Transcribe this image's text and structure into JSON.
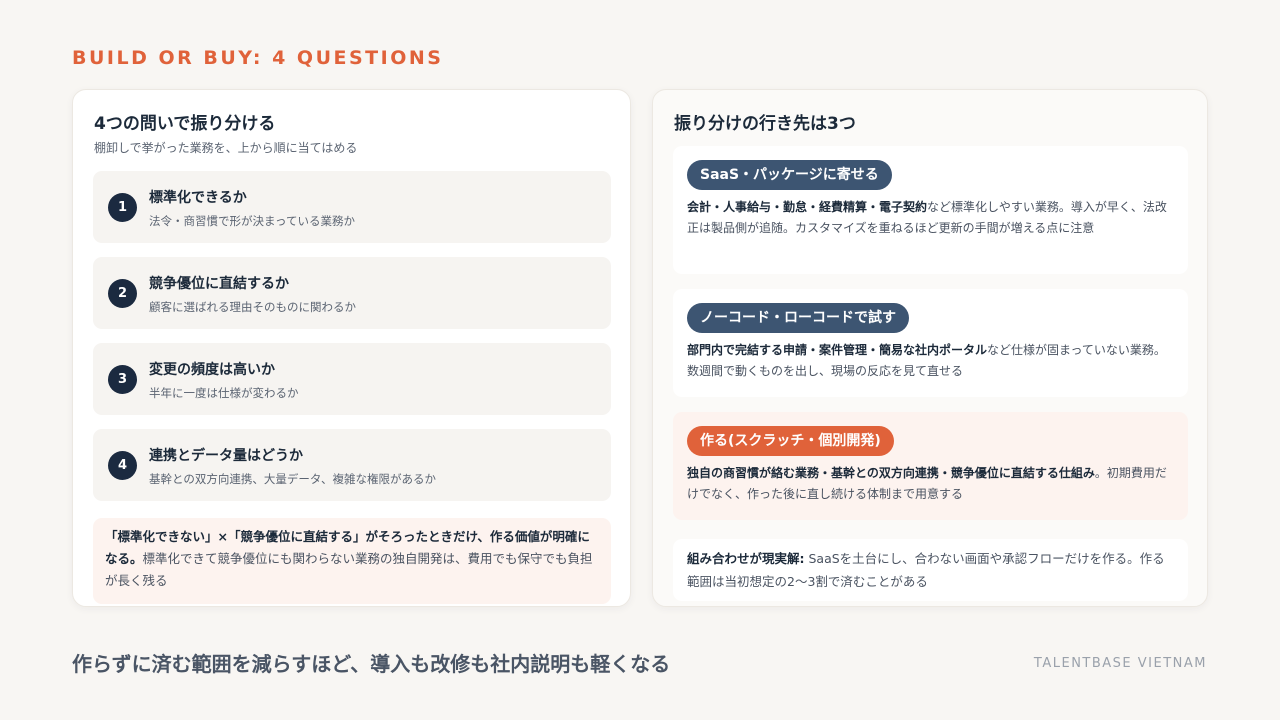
{
  "eyebrow": "BUILD OR BUY: 4 QUESTIONS",
  "left": {
    "title": "4つの問いで振り分ける",
    "subtitle": "棚卸しで挙がった業務を、上から順に当てはめる",
    "questions": [
      {
        "num": "1",
        "title": "標準化できるか",
        "desc": "法令・商習慣で形が決まっている業務か"
      },
      {
        "num": "2",
        "title": "競争優位に直結するか",
        "desc": "顧客に選ばれる理由そのものに関わるか"
      },
      {
        "num": "3",
        "title": "変更の頻度は高いか",
        "desc": "半年に一度は仕様が変わるか"
      },
      {
        "num": "4",
        "title": "連携とデータ量はどうか",
        "desc": "基幹との双方向連携、大量データ、複雑な権限があるか"
      }
    ],
    "note_bold": "「標準化できない」×「競争優位に直結する」がそろったときだけ、作る価値が明確になる。",
    "note_rest": "標準化できて競争優位にも関わらない業務の独自開発は、費用でも保守でも負担が長く残る"
  },
  "right": {
    "title": "振り分けの行き先は3つ",
    "destinations": [
      {
        "label": "SaaS・パッケージに寄せる",
        "bold": "会計・人事給与・勤怠・経費精算・電子契約",
        "rest": "など標準化しやすい業務。導入が早く、法改正は製品側が追随。カスタマイズを重ねるほど更新の手間が増える点に注意"
      },
      {
        "label": "ノーコード・ローコードで試す",
        "bold": "部門内で完結する申請・案件管理・簡易な社内ポータル",
        "rest": "など仕様が固まっていない業務。数週間で動くものを出し、現場の反応を見て直せる"
      },
      {
        "label": "作る(スクラッチ・個別開発)",
        "bold": "独自の商習慣が絡む業務・基幹との双方向連携・競争優位に直結する仕組み",
        "rest": "。初期費用だけでなく、作った後に直し続ける体制まで用意する"
      }
    ],
    "combo_bold": "組み合わせが現実解:",
    "combo_rest": " SaaSを土台にし、合わない画面や承認フローだけを作る。作る範囲は当初想定の2〜3割で済むことがある"
  },
  "footer_message": "作らずに済む範囲を減らすほど、導入も改修も社内説明も軽くなる",
  "brand": "TALENTBASE VIETNAM",
  "colors": {
    "accent": "#e0623a",
    "navy": "#1b2a40",
    "pill_blue": "#3d5572"
  }
}
